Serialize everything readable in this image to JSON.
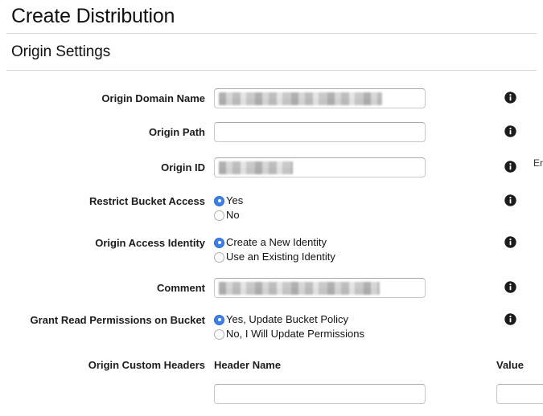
{
  "page": {
    "title": "Create Distribution",
    "section_title": "Origin Settings"
  },
  "fields": {
    "origin_domain_name": {
      "label": "Origin Domain Name",
      "value": "",
      "redacted": true
    },
    "origin_path": {
      "label": "Origin Path",
      "value": "",
      "redacted": false
    },
    "origin_id": {
      "label": "Origin ID",
      "value": "",
      "redacted": true,
      "help_text_clipped": "Er fo"
    },
    "restrict_bucket_access": {
      "label": "Restrict Bucket Access",
      "options": [
        "Yes",
        "No"
      ],
      "selected": "Yes"
    },
    "origin_access_identity": {
      "label": "Origin Access Identity",
      "options": [
        "Create a New Identity",
        "Use an Existing Identity"
      ],
      "selected": "Create a New Identity"
    },
    "comment": {
      "label": "Comment",
      "value": "",
      "redacted": true
    },
    "grant_read_permissions": {
      "label": "Grant Read Permissions on Bucket",
      "options": [
        "Yes, Update Bucket Policy",
        "No, I Will Update Permissions"
      ],
      "selected": "Yes, Update Bucket Policy"
    },
    "origin_custom_headers": {
      "label": "Origin Custom Headers",
      "columns": [
        "Header Name",
        "Value"
      ],
      "header_name_value": "",
      "value_value": ""
    }
  },
  "icons": {
    "info": "info-icon"
  },
  "colors": {
    "radio_selected": "#3b7fe8",
    "rule": "#d6d6d6",
    "input_border": "#c8c8c8",
    "text": "#111111"
  }
}
